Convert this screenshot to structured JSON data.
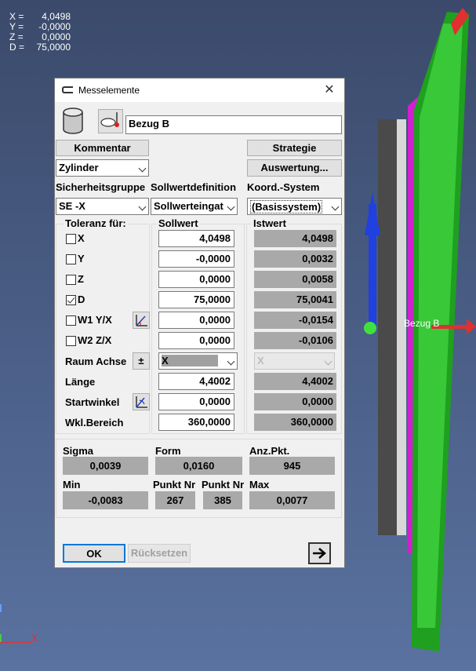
{
  "viewport": {
    "coords": [
      {
        "k": "X =",
        "v": "4,0498"
      },
      {
        "k": "Y =",
        "v": "-0,0000"
      },
      {
        "k": "Z =",
        "v": "0,0000"
      },
      {
        "k": "D =",
        "v": "75,0000"
      }
    ],
    "model_label": "Bezug B",
    "axis_label_x": "X"
  },
  "dialog": {
    "title": "Messelemente",
    "name_value": "Bezug B",
    "kommentar": "Kommentar",
    "strategie": "Strategie",
    "element_type": "Zylinder",
    "auswertung": "Auswertung...",
    "sicherheitsgruppe_label": "Sicherheitsgruppe",
    "sollwertdefinition_label": "Sollwertdefinition",
    "koord_label": "Koord.-System",
    "sicherheitsgruppe": "SE -X",
    "sollwertdefinition": "Sollwerteingat",
    "koord": "(Basissystem)",
    "toleranz_header": "Toleranz für:",
    "soll_header": "Sollwert",
    "ist_header": "Istwert",
    "rows": [
      {
        "label": "X",
        "checked": false,
        "soll": "4,0498",
        "ist": "4,0498"
      },
      {
        "label": "Y",
        "checked": false,
        "soll": "-0,0000",
        "ist": "0,0032"
      },
      {
        "label": "Z",
        "checked": false,
        "soll": "0,0000",
        "ist": "0,0058"
      },
      {
        "label": "D",
        "checked": true,
        "soll": "75,0000",
        "ist": "75,0041"
      },
      {
        "label": "W1 Y/X",
        "checked": false,
        "soll": "0,0000",
        "ist": "-0,0154"
      },
      {
        "label": "W2 Z/X",
        "checked": false,
        "soll": "0,0000",
        "ist": "-0,0106"
      }
    ],
    "raum_achse_label": "Raum Achse",
    "raum_achse_button": "±",
    "raum_achse_value": "X",
    "raum_achse_ist": "X",
    "laenge_label": "Länge",
    "laenge_soll": "4,4002",
    "laenge_ist": "4,4002",
    "startwinkel_label": "Startwinkel",
    "startwinkel_soll": "0,0000",
    "startwinkel_ist": "0,0000",
    "wkl_label": "Wkl.Bereich",
    "wkl_soll": "360,0000",
    "wkl_ist": "360,0000",
    "stats": {
      "sigma_label": "Sigma",
      "sigma": "0,0039",
      "form_label": "Form",
      "form": "0,0160",
      "anz_label": "Anz.Pkt.",
      "anz": "945",
      "min_label": "Min",
      "min": "-0,0083",
      "punkt1_label": "Punkt Nr",
      "punkt1": "267",
      "punkt2_label": "Punkt Nr",
      "punkt2": "385",
      "max_label": "Max",
      "max": "0,0077"
    },
    "ok": "OK",
    "reset": "Rücksetzen"
  }
}
